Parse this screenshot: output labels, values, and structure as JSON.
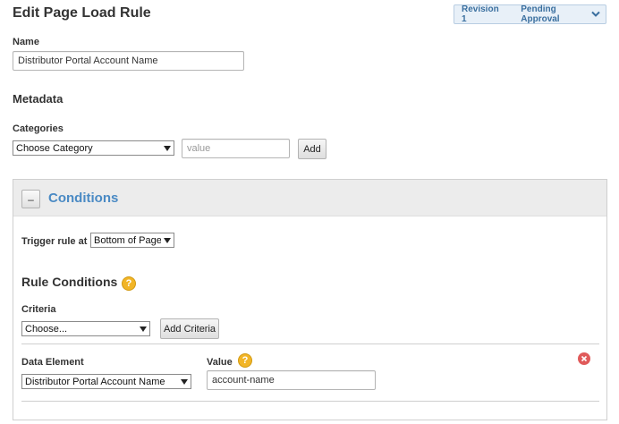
{
  "page": {
    "title": "Edit Page Load Rule"
  },
  "revision": {
    "label": "Revision 1",
    "status": "Pending Approval"
  },
  "name_field": {
    "label": "Name",
    "value": "Distributor Portal Account Name"
  },
  "metadata": {
    "heading": "Metadata",
    "categories_label": "Categories",
    "category_select": "Choose Category",
    "value_placeholder": "value",
    "add_button": "Add"
  },
  "conditions": {
    "collapse_symbol": "–",
    "title": "Conditions",
    "trigger_label": "Trigger rule at",
    "trigger_value": "Bottom of Page",
    "rule_conditions_heading": "Rule Conditions",
    "criteria_label": "Criteria",
    "criteria_select": "Choose...",
    "add_criteria_button": "Add Criteria",
    "data_element_label": "Data Element",
    "data_element_value": "Distributor Portal Account Name",
    "value_label": "Value",
    "value_input": "account-name"
  },
  "icons": {
    "help": "?",
    "help_color": "#f2b527",
    "remove_color": "#e05a5a",
    "accent_color": "#4a8ac4"
  }
}
